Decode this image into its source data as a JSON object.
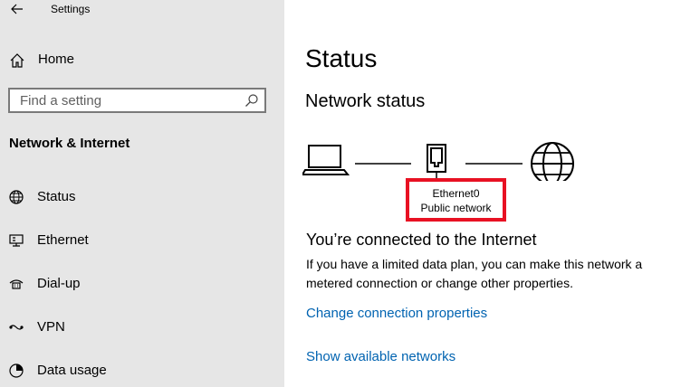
{
  "window": {
    "title": "Settings"
  },
  "sidebar": {
    "home_label": "Home",
    "search": {
      "placeholder": "Find a setting"
    },
    "section_heading": "Network & Internet",
    "items": [
      {
        "label": "Status",
        "icon": "status-icon"
      },
      {
        "label": "Ethernet",
        "icon": "ethernet-icon"
      },
      {
        "label": "Dial-up",
        "icon": "dialup-icon"
      },
      {
        "label": "VPN",
        "icon": "vpn-icon"
      },
      {
        "label": "Data usage",
        "icon": "data-usage-icon"
      }
    ]
  },
  "main": {
    "title": "Status",
    "network_status_heading": "Network status",
    "adapter": {
      "name": "Ethernet0",
      "network_type": "Public network"
    },
    "connected_heading": "You’re connected to the Internet",
    "description": "If you have a limited data plan, you can make this network a metered connection or change other properties.",
    "links": {
      "change_connection": "Change connection properties",
      "show_networks": "Show available networks"
    }
  },
  "colors": {
    "sidebar_bg": "#e6e6e6",
    "link": "#0063b1",
    "highlight_box": "#e81123"
  }
}
